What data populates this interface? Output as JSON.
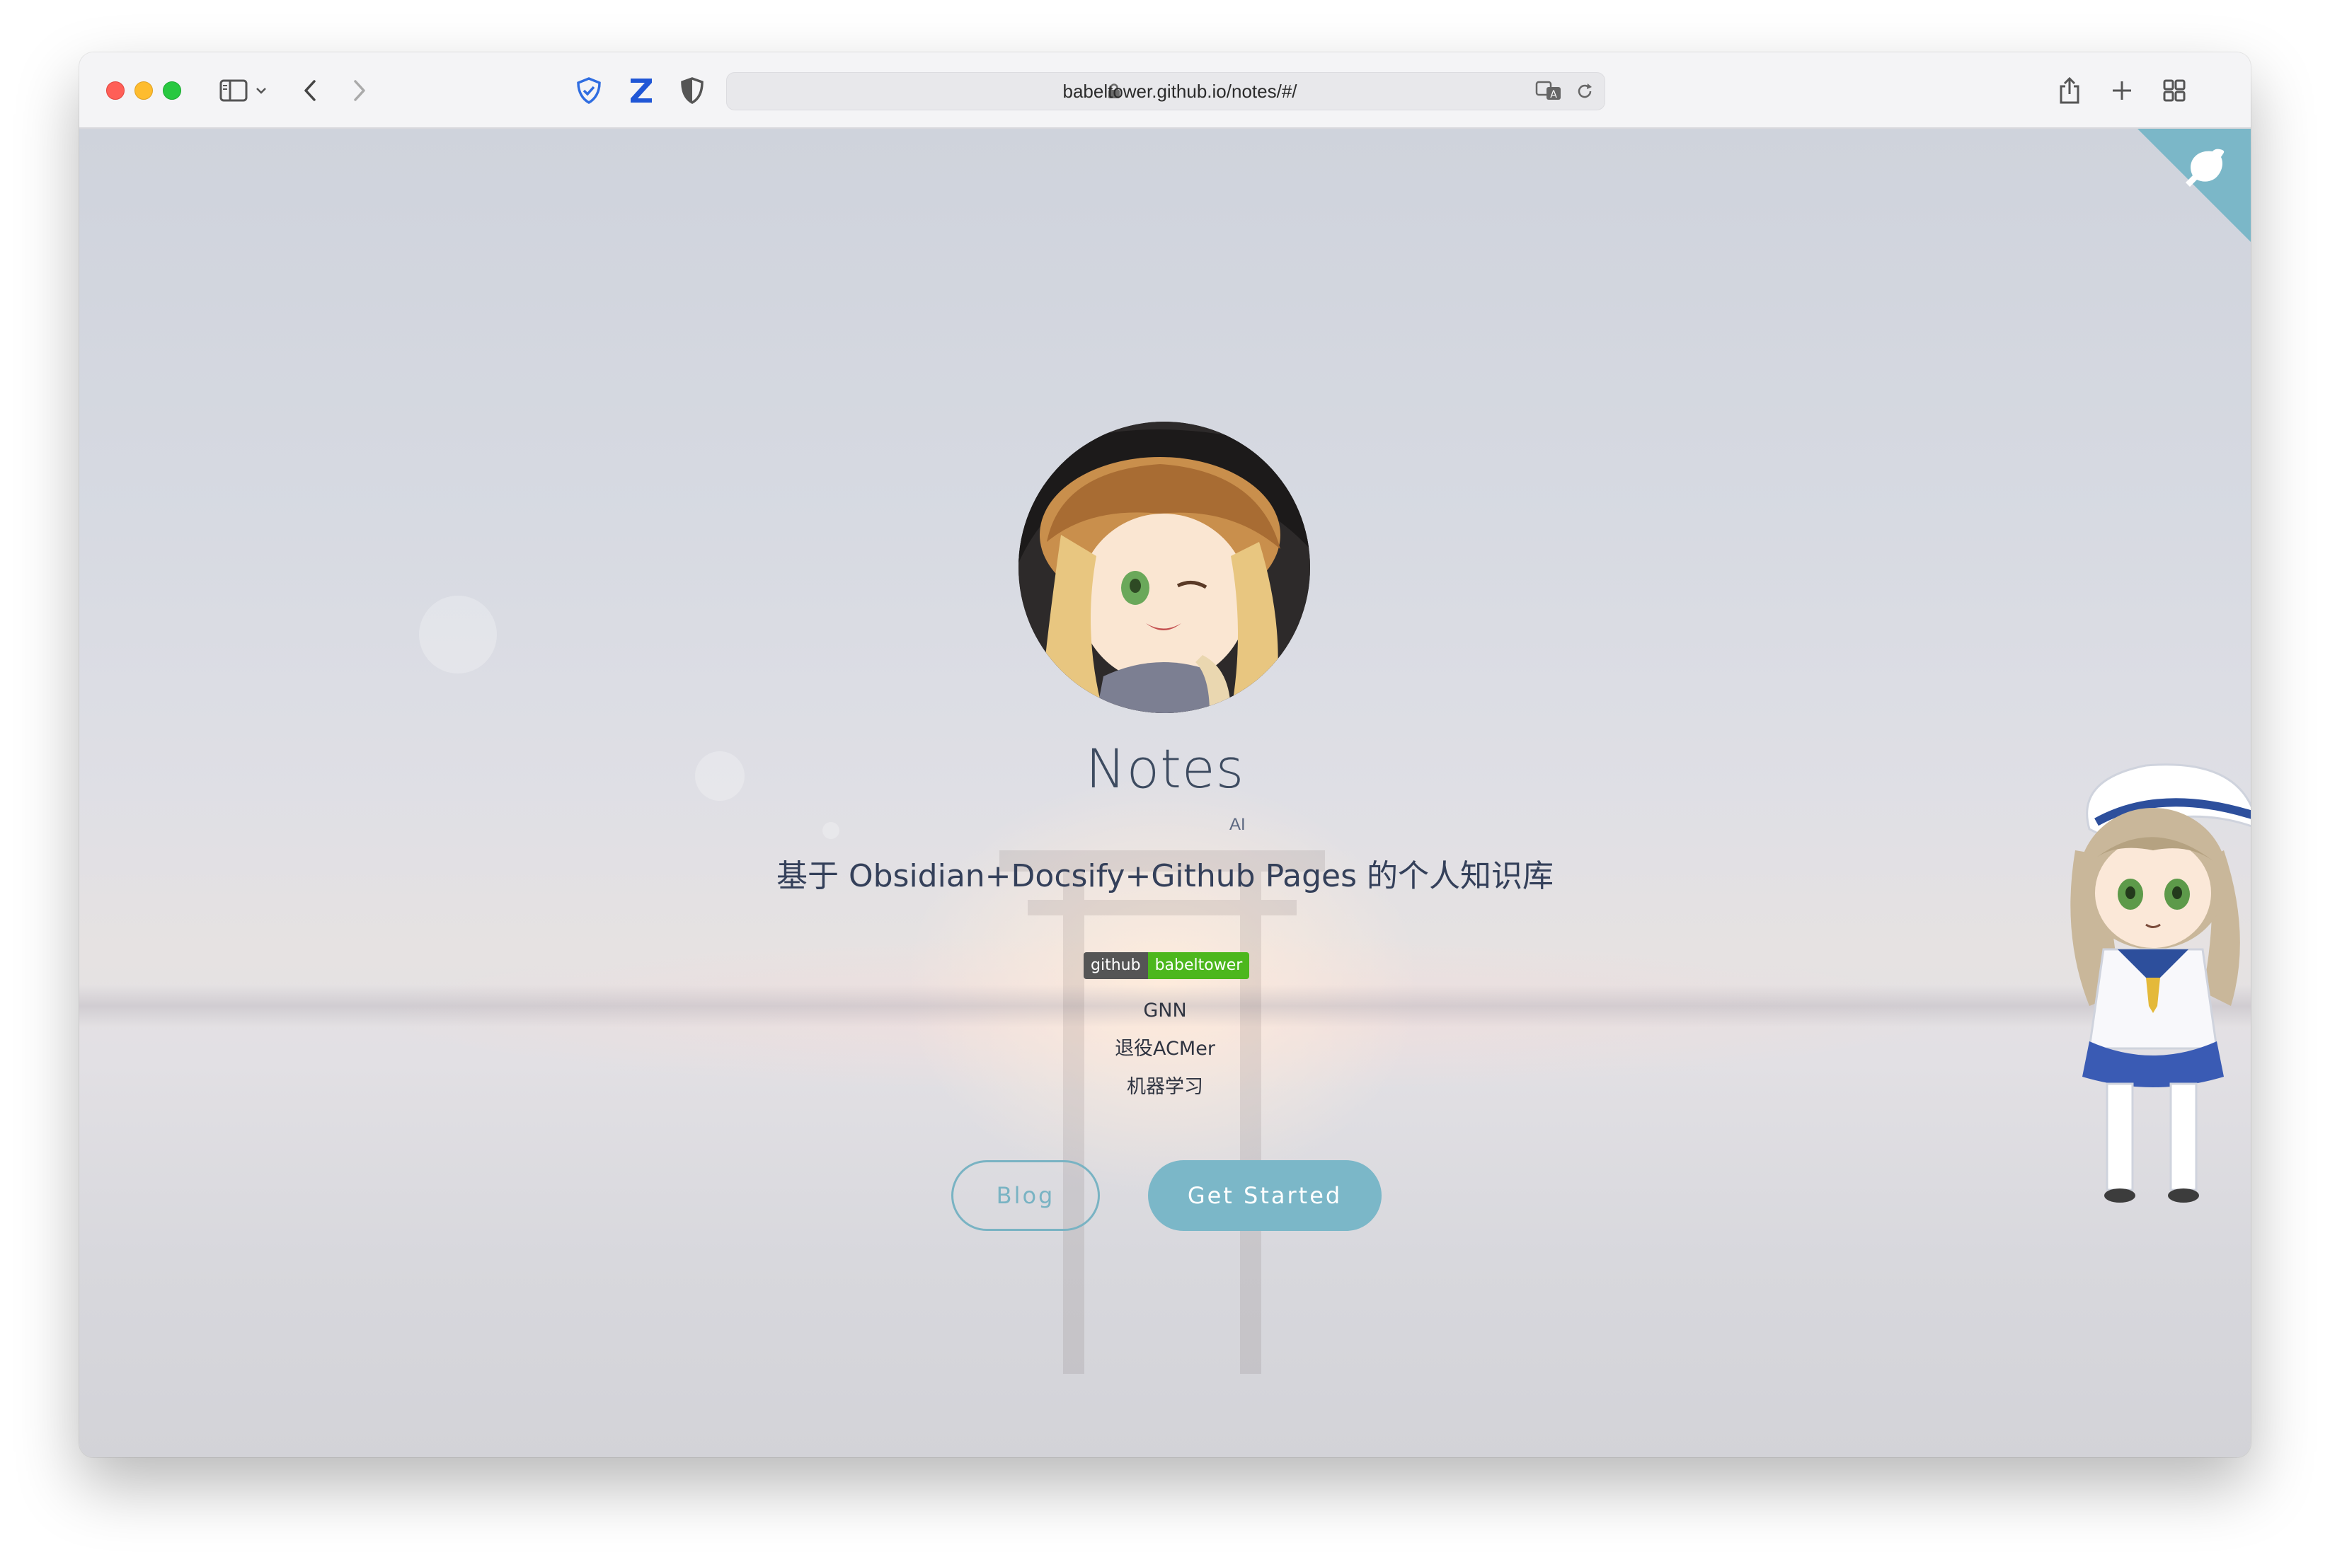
{
  "browser": {
    "url": "babeltower.github.io/notes/#/"
  },
  "hero": {
    "title": "Notes",
    "title_sup": "AI",
    "subtitle": "基于 Obsidian+Docsify+Github Pages 的个人知识库",
    "badge": {
      "left": "github",
      "right": "babeltower"
    },
    "tags": [
      "GNN",
      "退役ACMer",
      "机器学习"
    ],
    "buttons": {
      "blog": "Blog",
      "start": "Get Started"
    }
  },
  "colors": {
    "accent": "#7bb7c8",
    "title": "#3d4b60",
    "badge_green": "#4cb71d"
  },
  "icons": [
    "sidebar-icon",
    "chevron-down-icon",
    "back-icon",
    "forward-icon",
    "shield-check-icon",
    "zotero-icon",
    "privacy-shield-icon",
    "lock-icon",
    "translate-icon",
    "reload-icon",
    "share-icon",
    "new-tab-icon",
    "tab-overview-icon",
    "github-corner-icon"
  ]
}
